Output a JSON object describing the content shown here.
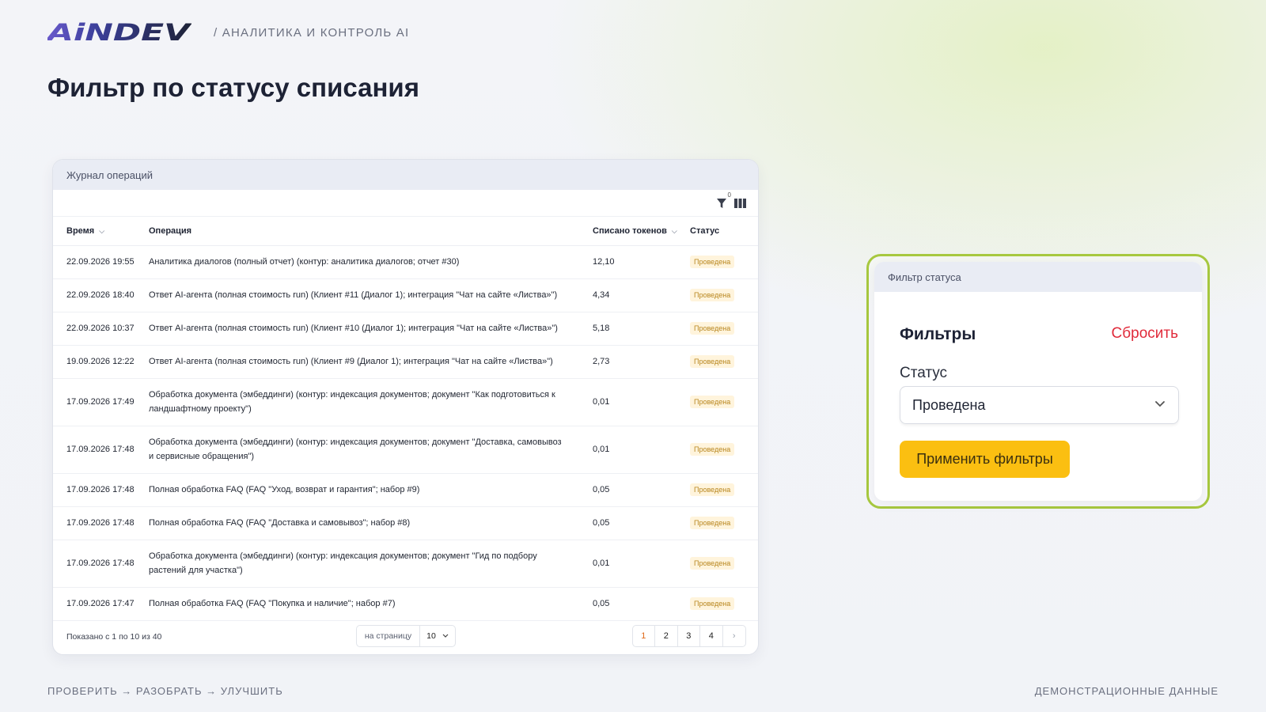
{
  "header": {
    "logo_text": "AiNDEV",
    "subtitle": "/ АНАЛИТИКА И КОНТРОЛЬ AI"
  },
  "page_title": "Фильтр по статусу списания",
  "journal": {
    "title": "Журнал операций",
    "filter_count": "0",
    "columns": {
      "time": "Время",
      "operation": "Операция",
      "tokens": "Списано токенов",
      "status": "Статус"
    },
    "rows": [
      {
        "time": "22.09.2026 19:55",
        "op": "Аналитика диалогов (полный отчет) (контур: аналитика диалогов; отчет #30)",
        "tokens": "12,10",
        "status": "Проведена"
      },
      {
        "time": "22.09.2026 18:40",
        "op": "Ответ AI-агента (полная стоимость run) (Клиент #11 (Диалог 1); интеграция \"Чат на сайте «Листва»\")",
        "tokens": "4,34",
        "status": "Проведена"
      },
      {
        "time": "22.09.2026 10:37",
        "op": "Ответ AI-агента (полная стоимость run) (Клиент #10 (Диалог 1); интеграция \"Чат на сайте «Листва»\")",
        "tokens": "5,18",
        "status": "Проведена"
      },
      {
        "time": "19.09.2026 12:22",
        "op": "Ответ AI-агента (полная стоимость run) (Клиент #9 (Диалог 1); интеграция \"Чат на сайте «Листва»\")",
        "tokens": "2,73",
        "status": "Проведена"
      },
      {
        "time": "17.09.2026 17:49",
        "op": "Обработка документа (эмбеддинги) (контур: индексация документов; документ \"Как подготовиться к ландшафтному проекту\")",
        "tokens": "0,01",
        "status": "Проведена"
      },
      {
        "time": "17.09.2026 17:48",
        "op": "Обработка документа (эмбеддинги) (контур: индексация документов; документ \"Доставка, самовывоз и сервисные обращения\")",
        "tokens": "0,01",
        "status": "Проведена"
      },
      {
        "time": "17.09.2026 17:48",
        "op": "Полная обработка FAQ (FAQ \"Уход, возврат и гарантия\"; набор #9)",
        "tokens": "0,05",
        "status": "Проведена"
      },
      {
        "time": "17.09.2026 17:48",
        "op": "Полная обработка FAQ (FAQ \"Доставка и самовывоз\"; набор #8)",
        "tokens": "0,05",
        "status": "Проведена"
      },
      {
        "time": "17.09.2026 17:48",
        "op": "Обработка документа (эмбеддинги) (контур: индексация документов; документ \"Гид по подбору растений для участка\")",
        "tokens": "0,01",
        "status": "Проведена"
      },
      {
        "time": "17.09.2026 17:47",
        "op": "Полная обработка FAQ (FAQ \"Покупка и наличие\"; набор #7)",
        "tokens": "0,05",
        "status": "Проведена"
      }
    ],
    "footer": {
      "shown": "Показано с 1 по 10 из 40",
      "per_page_label": "на страницу",
      "per_page_value": "10",
      "pages": [
        "1",
        "2",
        "3",
        "4"
      ],
      "next": "›"
    }
  },
  "filter_panel": {
    "title": "Фильтр статуса",
    "heading": "Фильтры",
    "reset": "Сбросить",
    "status_label": "Статус",
    "status_value": "Проведена",
    "apply": "Применить фильтры"
  },
  "bottom": {
    "left": "ПРОВЕРИТЬ → РАЗОБРАТЬ → УЛУЧШИТЬ",
    "right": "ДЕМОНСТРАЦИОННЫЕ ДАННЫЕ"
  },
  "colors": {
    "accent_yellow": "#fbbf11",
    "reset_red": "#e02a3a",
    "frame_green": "#a7c83f",
    "badge_text": "#b8861e"
  }
}
